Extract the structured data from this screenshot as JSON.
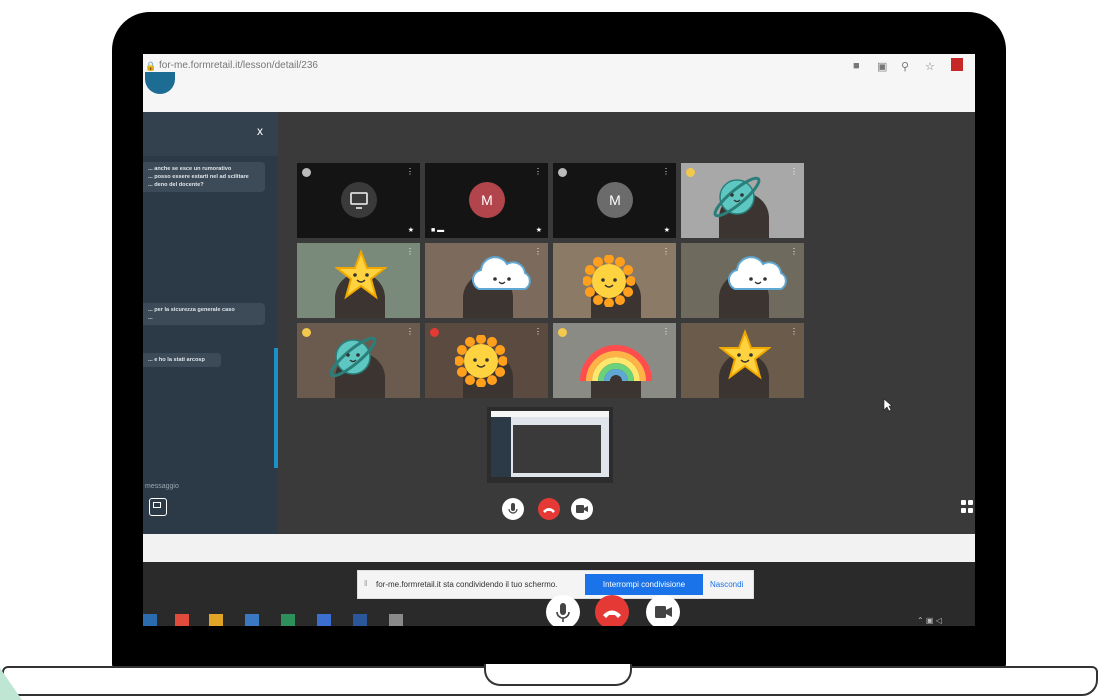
{
  "browser": {
    "url": "for-me.formretail.it/lesson/detail/236"
  },
  "chat": {
    "close": "x",
    "messages": [
      "... anche se esce un rumorativo\n... posso essere estarti nel ad scilitare\n... deno del docente?",
      "... per la sicurezza generale caso\n...",
      "... e ho la stati arcosp"
    ],
    "input_placeholder": "messaggio"
  },
  "participants": [
    {
      "type": "avatar",
      "initial": "",
      "status": "#bbbbbb"
    },
    {
      "type": "avatar",
      "initial": "M",
      "status": "",
      "avatar_color": "#b2454c"
    },
    {
      "type": "avatar",
      "initial": "M",
      "status": "#bbbbbb",
      "avatar_color": "#6b6b6b"
    },
    {
      "type": "video",
      "sticker": "planet",
      "status": "#f2c94c"
    },
    {
      "type": "video",
      "sticker": "star"
    },
    {
      "type": "video",
      "sticker": "cloud"
    },
    {
      "type": "video",
      "sticker": "sun"
    },
    {
      "type": "video",
      "sticker": "cloud"
    },
    {
      "type": "video",
      "sticker": "planet",
      "status": "#f2c94c"
    },
    {
      "type": "video",
      "sticker": "sun",
      "status": "#e53935"
    },
    {
      "type": "video",
      "sticker": "rainbow",
      "status": "#f2c94c"
    },
    {
      "type": "video",
      "sticker": "star"
    }
  ],
  "share_bar": {
    "message": "for-me.formretail.it sta condividendo il tuo schermo.",
    "stop_label": "Interrompi condivisione",
    "hide_label": "Nascondi"
  },
  "colors": {
    "hangup": "#e53935",
    "accent": "#1a73e8",
    "chat_bg": "#2c3a47"
  },
  "icons": {
    "mic": "microphone-icon",
    "hangup": "hangup-icon",
    "camera": "camera-icon"
  }
}
